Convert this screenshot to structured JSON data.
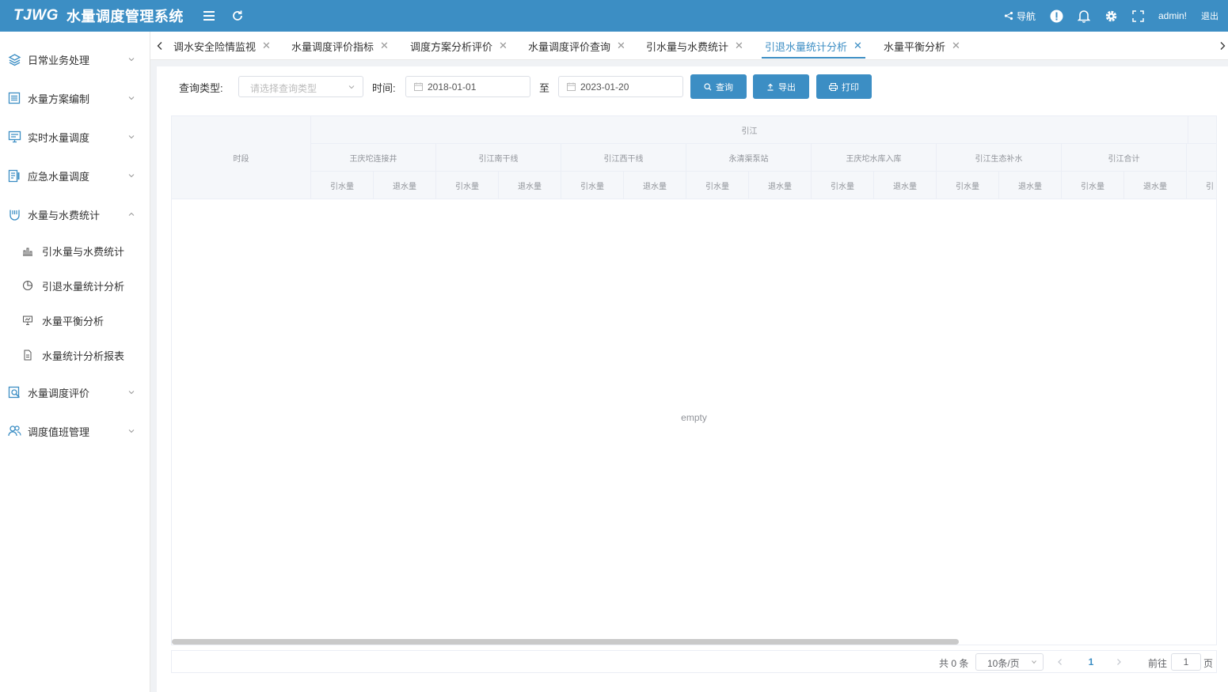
{
  "header": {
    "brand": "TJWG",
    "title": "水量调度管理系统",
    "nav_label": "导航",
    "user": "admin!",
    "logout": "退出"
  },
  "sidebar": {
    "items": [
      {
        "label": "日常业务处理",
        "icon": "layers-icon"
      },
      {
        "label": "水量方案编制",
        "icon": "list-icon"
      },
      {
        "label": "实时水量调度",
        "icon": "monitor-icon"
      },
      {
        "label": "应急水量调度",
        "icon": "document-icon"
      },
      {
        "label": "水量与水费统计",
        "icon": "chart-frame-icon"
      },
      {
        "label": "水量调度评价",
        "icon": "search-doc-icon"
      },
      {
        "label": "调度值班管理",
        "icon": "users-icon"
      }
    ],
    "sub_items": [
      {
        "label": "引水量与水费统计",
        "icon": "bar-chart-icon"
      },
      {
        "label": "引退水量统计分析",
        "icon": "pie-chart-icon"
      },
      {
        "label": "水量平衡分析",
        "icon": "presentation-icon"
      },
      {
        "label": "水量统计分析报表",
        "icon": "file-icon"
      }
    ]
  },
  "tabs": [
    {
      "label": "调水安全险情监视"
    },
    {
      "label": "水量调度评价指标"
    },
    {
      "label": "调度方案分析评价"
    },
    {
      "label": "水量调度评价查询"
    },
    {
      "label": "引水量与水费统计"
    },
    {
      "label": "引退水量统计分析",
      "active": true
    },
    {
      "label": "水量平衡分析"
    }
  ],
  "filters": {
    "type_label": "查询类型:",
    "type_placeholder": "请选择查询类型",
    "time_label": "时间:",
    "start_date": "2018-01-01",
    "to_label": "至",
    "end_date": "2023-01-20",
    "query_btn": "查询",
    "export_btn": "导出",
    "print_btn": "打印"
  },
  "table": {
    "period_header": "时段",
    "group_header": "引江",
    "sub_groups": [
      "王庆坨连接井",
      "引江南干线",
      "引江西干线",
      "永清渠泵站",
      "王庆坨水库入库",
      "引江生态补水",
      "引江合计"
    ],
    "col_in": "引水量",
    "col_out": "退水量",
    "partial_col": "引",
    "empty_text": "empty"
  },
  "pagination": {
    "total": "共 0 条",
    "page_size": "10条/页",
    "current_page": "1",
    "goto_label": "前往",
    "goto_value": "1",
    "page_unit": "页"
  },
  "colors": {
    "primary": "#3c8ec4"
  }
}
